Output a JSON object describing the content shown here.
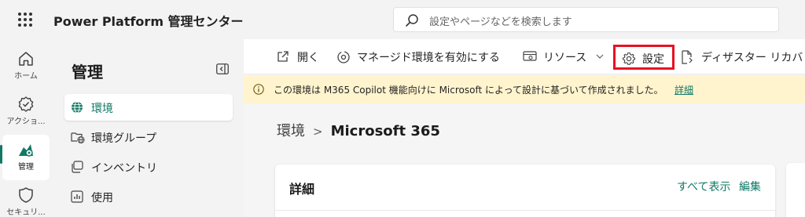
{
  "header": {
    "app_title": "Power Platform 管理センター",
    "search_placeholder": "設定やページなどを検索します"
  },
  "rail": {
    "items": [
      {
        "label": "ホーム",
        "icon": "home-icon"
      },
      {
        "label": "アクショ...",
        "icon": "action-icon"
      },
      {
        "label": "管理",
        "icon": "manage-icon",
        "active": true
      },
      {
        "label": "セキュリ...",
        "icon": "shield-icon"
      }
    ]
  },
  "nav": {
    "title": "管理",
    "items": [
      {
        "label": "環境",
        "icon": "globe-icon",
        "active": true
      },
      {
        "label": "環境グループ",
        "icon": "folder-globe-icon"
      },
      {
        "label": "インベントリ",
        "icon": "inventory-icon"
      },
      {
        "label": "使用",
        "icon": "chart-icon"
      }
    ]
  },
  "commands": {
    "open": "開く",
    "managed": "マネージド環境を有効にする",
    "resources": "リソース",
    "settings": "設定",
    "designer": "ディザスター リカバ"
  },
  "notice": {
    "message": "この環境は M365 Copilot 機能向けに Microsoft によって設計に基づいて作成されました。",
    "link": "詳細"
  },
  "breadcrumb": {
    "parent": "環境",
    "separator": ">",
    "current": "Microsoft 365"
  },
  "card": {
    "title": "詳細",
    "show_all": "すべて表示",
    "edit": "編集"
  },
  "colors": {
    "accent": "#117865",
    "highlight_border": "#e81123",
    "notice_bg": "#fff4ce"
  }
}
